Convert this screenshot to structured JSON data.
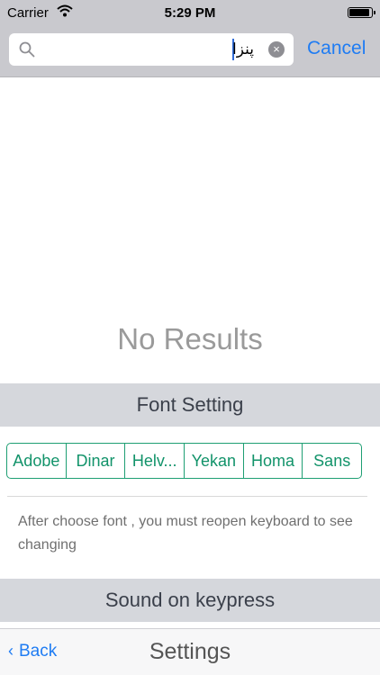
{
  "status_bar": {
    "carrier": "Carrier",
    "time": "5:29 PM"
  },
  "search": {
    "query": "پنزا",
    "cancel_label": "Cancel",
    "clear_label": "×"
  },
  "results": {
    "empty_message": "No Results"
  },
  "font_setting": {
    "header": "Font Setting",
    "options": [
      "Adobe",
      "Dinar",
      "Helv...",
      "Yekan",
      "Homa",
      "Sans"
    ],
    "note": "After choose font , you must reopen keyboard to see changing",
    "accent_color": "#1e9f73"
  },
  "sound_setting": {
    "header": "Sound on keypress"
  },
  "tab_bar": {
    "back_label": "Back",
    "back_chevron": "‹",
    "title": "Settings"
  },
  "colors": {
    "link": "#1f7cf3",
    "section_bg": "#d5d7dc",
    "top_bar_bg": "#c9c9ce"
  }
}
